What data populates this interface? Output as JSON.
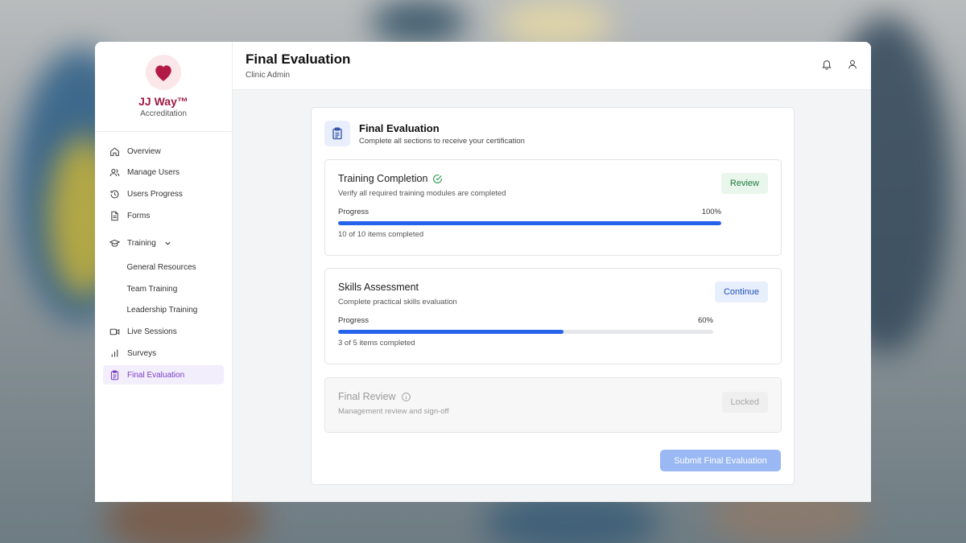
{
  "brand": {
    "name": "JJ Way™",
    "subtitle": "Accreditation"
  },
  "sidebar": {
    "items": [
      {
        "label": "Overview",
        "icon": "home-icon"
      },
      {
        "label": "Manage Users",
        "icon": "users-icon"
      },
      {
        "label": "Users Progress",
        "icon": "history-icon"
      },
      {
        "label": "Forms",
        "icon": "document-icon"
      },
      {
        "label": "Training",
        "icon": "graduation-cap-icon"
      },
      {
        "label": "General Resources"
      },
      {
        "label": "Team Training"
      },
      {
        "label": "Leadership Training"
      },
      {
        "label": "Live Sessions",
        "icon": "video-icon"
      },
      {
        "label": "Surveys",
        "icon": "bar-chart-icon"
      },
      {
        "label": "Final Evaluation",
        "icon": "clipboard-icon",
        "active": true
      }
    ]
  },
  "header": {
    "title": "Final Evaluation",
    "subtitle": "Clinic Admin"
  },
  "card": {
    "title": "Final Evaluation",
    "subtitle": "Complete all sections to receive your certification",
    "sections": [
      {
        "title": "Training Completion",
        "desc": "Verify all required training modules are completed",
        "progress_label": "Progress",
        "progress_text": "100%",
        "progress_value": 1.0,
        "items_text": "10 of 10 items completed",
        "button": "Review",
        "status": "complete"
      },
      {
        "title": "Skills Assessment",
        "desc": "Complete practical skills evaluation",
        "progress_label": "Progress",
        "progress_text": "60%",
        "progress_value": 0.6,
        "items_text": "3 of 5 items completed",
        "button": "Continue",
        "status": "in-progress"
      },
      {
        "title": "Final Review",
        "desc": "Management review and sign-off",
        "button": "Locked",
        "status": "locked"
      }
    ],
    "submit_label": "Submit Final Evaluation"
  },
  "colors": {
    "brand": "#a11a43",
    "accent": "#2563eb",
    "active_nav": "#7a3fc4",
    "success": "#1f7a3a"
  }
}
